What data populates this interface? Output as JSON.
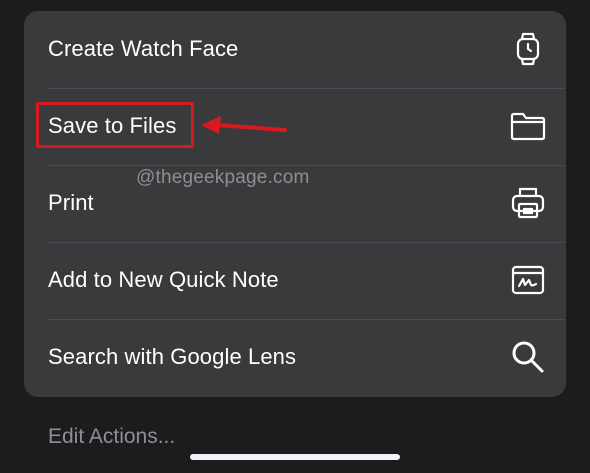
{
  "menu": {
    "items": [
      {
        "label": "Create Watch Face",
        "icon": "watch-icon"
      },
      {
        "label": "Save to Files",
        "icon": "folder-icon"
      },
      {
        "label": "Print",
        "icon": "printer-icon"
      },
      {
        "label": "Add to New Quick Note",
        "icon": "quick-note-icon"
      },
      {
        "label": "Search with Google Lens",
        "icon": "search-icon"
      }
    ]
  },
  "watermark": "@thegeekpage.com",
  "footer": {
    "edit_actions_label": "Edit Actions..."
  },
  "colors": {
    "background": "#1c1c1e",
    "sheet": "#3a3a3c",
    "annotation": "#d71920",
    "secondary_text": "#8e8e93"
  }
}
